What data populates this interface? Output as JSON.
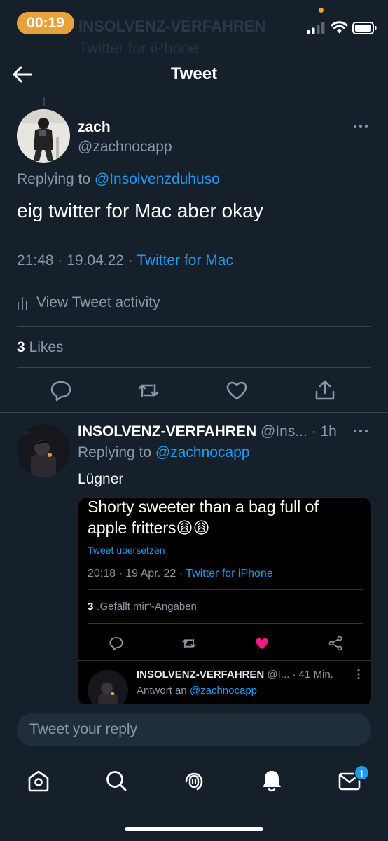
{
  "status_bar": {
    "time": "00:19"
  },
  "ghost": {
    "line1": "INSOLVENZ-VERFAHREN",
    "line2": "Twitter for iPhone"
  },
  "header": {
    "title": "Tweet"
  },
  "tweet": {
    "name": "zach",
    "handle": "@zachnocapp",
    "replying_prefix": "Replying to ",
    "replying_to": "@Insolvenzduhuso",
    "text": "eig twitter for Mac aber okay",
    "timestamp": "21:48 · 19.04.22 ·",
    "source": "Twitter for Mac",
    "activity_label": "View Tweet activity",
    "likes_count": "3",
    "likes_label": "Likes"
  },
  "reply": {
    "name": "INSOLVENZ-VERFAHREN",
    "handle": "@Ins...",
    "time": "· 1h",
    "replying_prefix": "Replying to ",
    "replying_to": "@zachnocapp",
    "text": "Lügner",
    "quoted": {
      "text_line1": "Shorty sweeter than a bag full of",
      "text_line2": "apple fritters😩😩",
      "translate": "Tweet übersetzen",
      "timestamp": "20:18 · 19 Apr. 22 ·",
      "source": "Twitter for iPhone",
      "likes_count": "3",
      "likes_label": "„Gefällt mir“-Angaben",
      "sub_name": "INSOLVENZ-VERFAHREN",
      "sub_handle": "@I...",
      "sub_time": "· 41 Min.",
      "sub_reply_prefix": "Antwort an ",
      "sub_reply_to": "@zachnocapp"
    }
  },
  "composer": {
    "placeholder": "Tweet your reply"
  },
  "tabbar": {
    "messages_badge": "1"
  },
  "colors": {
    "background": "#15202b",
    "accent": "#1d9bf0",
    "status_pill": "#e8a23b",
    "like_pink": "#f91880"
  }
}
